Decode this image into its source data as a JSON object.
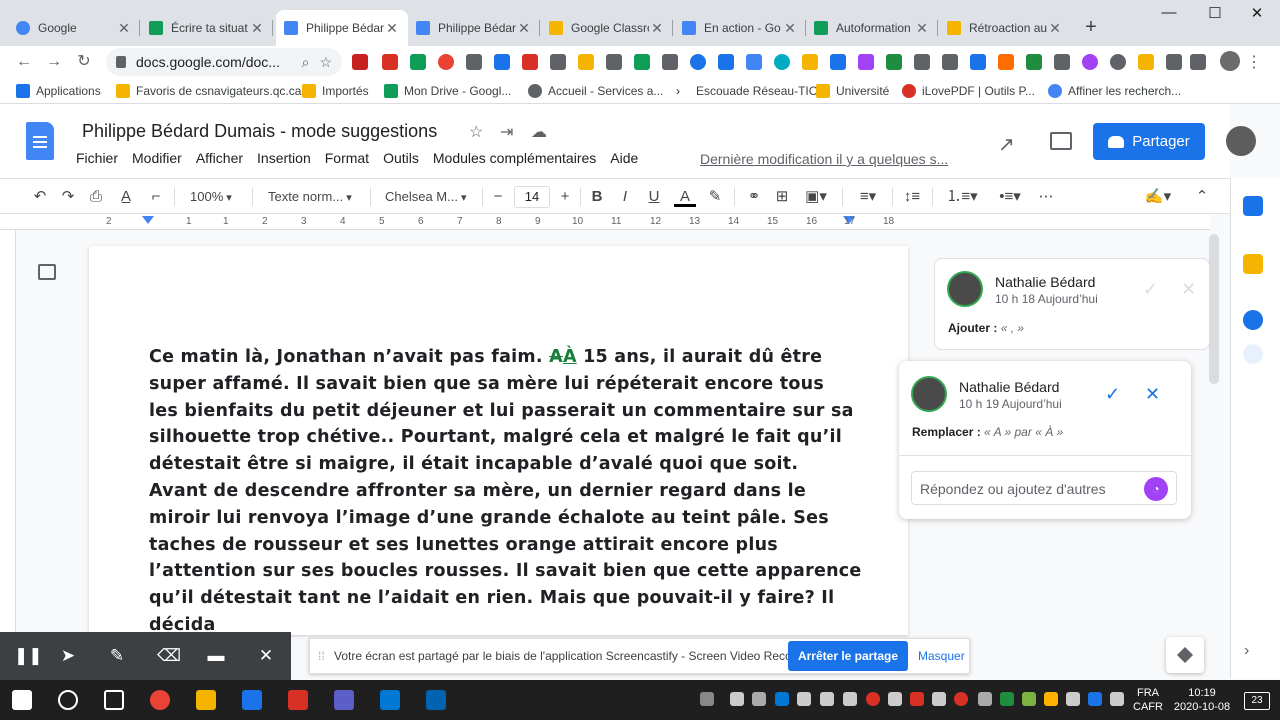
{
  "browser": {
    "tabs": [
      {
        "title": "Google",
        "active": false,
        "favicon_color": "#4285f4"
      },
      {
        "title": "Écrire ta situat",
        "active": false,
        "favicon_color": "#0f9d58"
      },
      {
        "title": "Philippe Bédar",
        "active": true,
        "favicon_color": "#4285f4"
      },
      {
        "title": "Philippe Bédar",
        "active": false,
        "favicon_color": "#4285f4"
      },
      {
        "title": "Google Classro",
        "active": false,
        "favicon_color": "#f4b400"
      },
      {
        "title": "En action - Go",
        "active": false,
        "favicon_color": "#4285f4"
      },
      {
        "title": "Autoformation",
        "active": false,
        "favicon_color": "#0f9d58"
      },
      {
        "title": "Rétroaction au",
        "active": false,
        "favicon_color": "#f4b400"
      }
    ],
    "new_tab": "+",
    "window_controls": {
      "minimize": "—",
      "maximize": "☐",
      "close": "✕"
    },
    "address": "docs.google.com/doc...",
    "bookmarks": [
      {
        "label": "Applications",
        "color": "#1a73e8"
      },
      {
        "label": "Favoris de csnavigateurs.qc.ca",
        "color": "#f4b400"
      },
      {
        "label": "Importés",
        "color": "#f4b400"
      },
      {
        "label": "Mon Drive - Googl...",
        "color": "#0f9d58"
      },
      {
        "label": "Accueil - Services a...",
        "color": "#5f6368"
      },
      {
        "label": "Escouade Réseau-TIC",
        "color": "#202124"
      },
      {
        "label": "Université",
        "color": "#f4b400"
      },
      {
        "label": "iLovePDF | Outils P...",
        "color": "#d93025"
      },
      {
        "label": "Affiner les recherch...",
        "color": "#4285f4"
      }
    ]
  },
  "docs": {
    "title": "Philippe Bédard Dumais - mode suggestions",
    "menu": [
      "Fichier",
      "Modifier",
      "Afficher",
      "Insertion",
      "Format",
      "Outils",
      "Modules complémentaires",
      "Aide"
    ],
    "last_modified": "Dernière modification il y a quelques s...",
    "share_label": "Partager",
    "toolbar": {
      "zoom": "100%",
      "style": "Texte norm...",
      "font": "Chelsea M...",
      "font_size": "14"
    },
    "ruler_numbers": [
      "2",
      "1",
      "1",
      "2",
      "3",
      "4",
      "5",
      "6",
      "7",
      "8",
      "9",
      "10",
      "11",
      "12",
      "13",
      "14",
      "15",
      "16",
      "17",
      "18"
    ],
    "body": {
      "line1_pre": "Ce matin là, Jonathan n’avait pas faim. ",
      "line1_del": "A",
      "line1_ins": "À",
      "line1_post": " 15 ans, il aurait dû être",
      "lines": [
        "super affamé. Il savait bien que sa mère lui répéterait  encore tous",
        "les bienfaits du petit déjeuner et lui passerait un commentaire sur sa",
        "silhouette trop chétive.. Pourtant, malgré cela et malgré le fait qu’il",
        "détestait être si maigre, il était incapable d’avalé quoi que soit.",
        "Avant de descendre affronter sa mère, un dernier regard dans le",
        "miroir lui renvoya l’image d’une grande échalote au teint pâle. Ses",
        "taches de rousseur et ses lunettes orange attirait encore plus",
        "l’attention sur ses boucles rousses. Il savait bien que cette apparence",
        "qu’il détestait tant ne l’aidait en rien. Mais que pouvait-il y faire? Il",
        "décida"
      ]
    }
  },
  "comments": [
    {
      "author": "Nathalie Bédard",
      "time": "10 h 18 Aujourd’hui",
      "label": "Ajouter :",
      "detail": "« , »"
    },
    {
      "author": "Nathalie Bédard",
      "time": "10 h 19 Aujourd’hui",
      "label": "Remplacer :",
      "detail": "« A » par « À »",
      "reply_placeholder": "Répondez ou ajoutez d'autres"
    }
  ],
  "screencastify": {
    "notice": "Votre écran est partagé par le biais de l'application Screencastify - Screen Video Recorder.",
    "stop_label": "Arrêter le partage",
    "hide_label": "Masquer"
  },
  "taskbar": {
    "language": "FRA",
    "layout": "CAFR",
    "time": "10:19",
    "date": "2020-10-08",
    "notif_count": "23"
  },
  "colors": {
    "accent": "#1a73e8",
    "suggestion": "#188038"
  }
}
